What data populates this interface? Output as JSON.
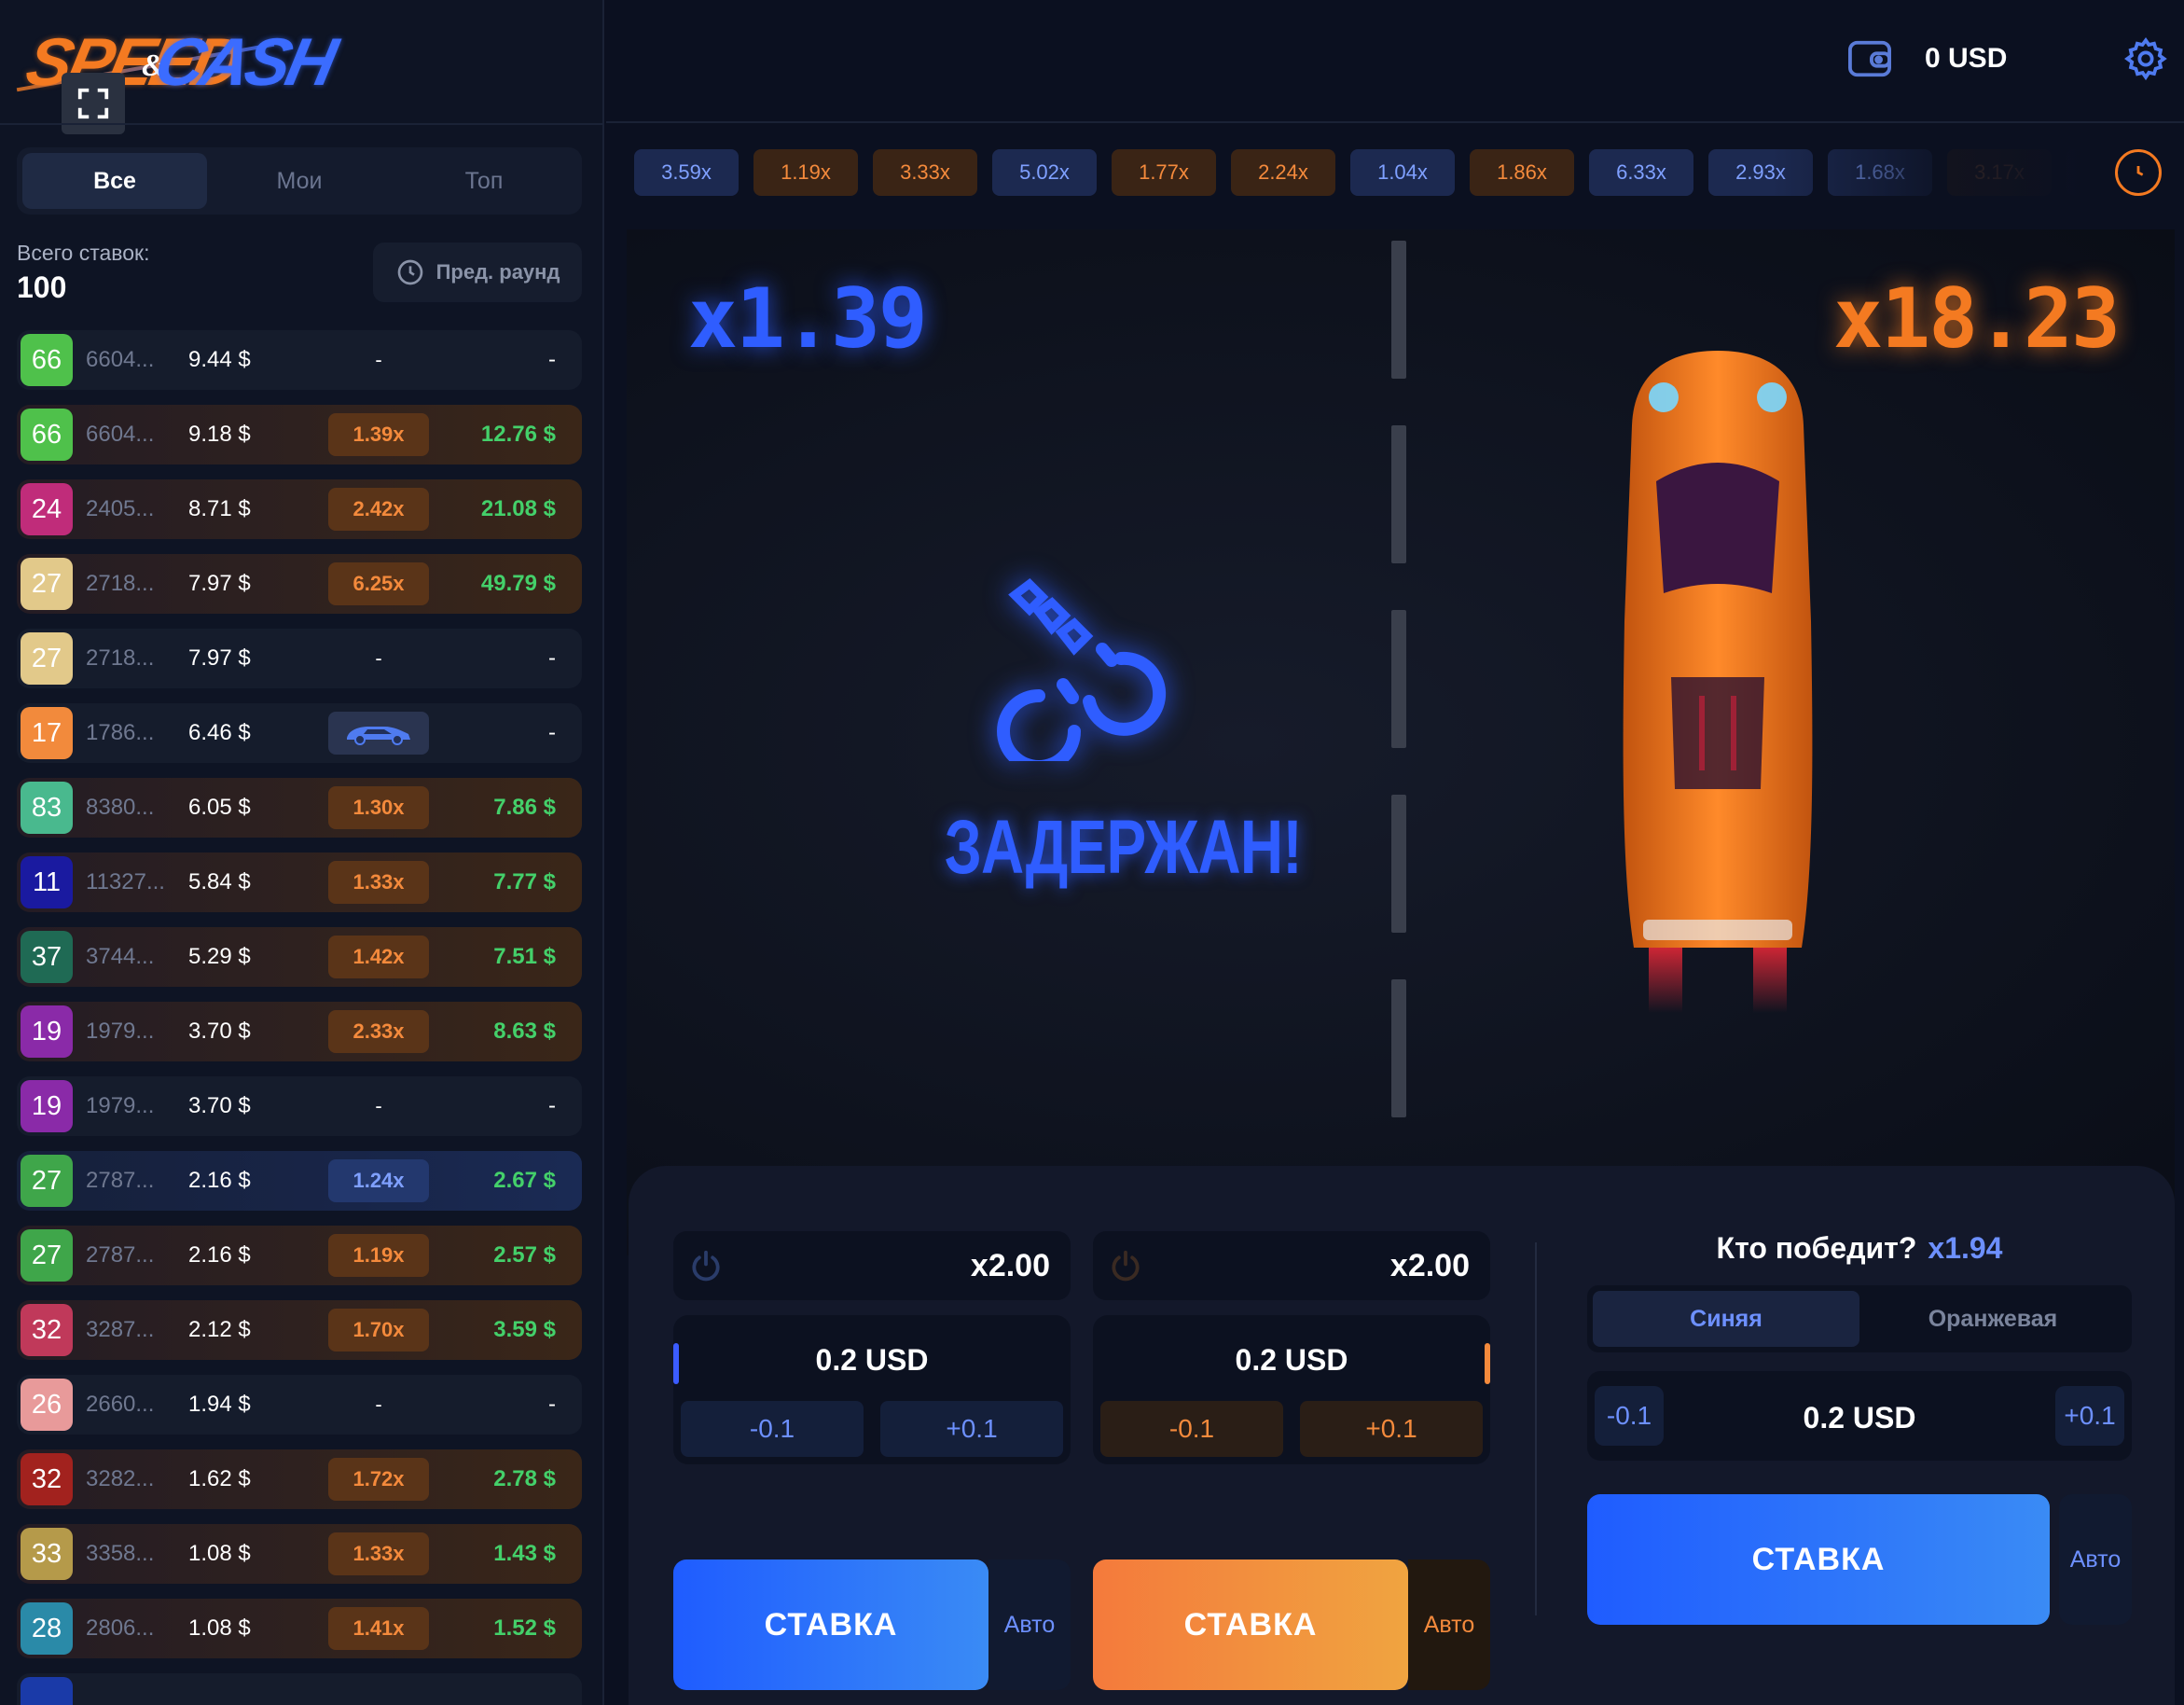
{
  "brand": {
    "word1": "SPEED",
    "amp": "&",
    "word2": "CASH"
  },
  "filters": [
    "Все",
    "Мои",
    "Топ"
  ],
  "total": {
    "label": "Всего ставок:",
    "value": "100"
  },
  "prev_round": "Пред. раунд",
  "balance": "0 USD",
  "bets": [
    {
      "level": "66",
      "color": "#4fc14b",
      "uid": "6604...",
      "amount": "9.44 $",
      "mult": "-",
      "mult_type": "dash",
      "win": "-",
      "row": "plain"
    },
    {
      "level": "66",
      "color": "#4fc14b",
      "uid": "6604...",
      "amount": "9.18 $",
      "mult": "1.39x",
      "mult_type": "orange",
      "win": "12.76 $",
      "row": "win"
    },
    {
      "level": "24",
      "color": "#c02c7a",
      "uid": "2405...",
      "amount": "8.71 $",
      "mult": "2.42x",
      "mult_type": "orange",
      "win": "21.08 $",
      "row": "win"
    },
    {
      "level": "27",
      "color": "#e2c98a",
      "uid": "2718...",
      "amount": "7.97 $",
      "mult": "6.25x",
      "mult_type": "orange",
      "win": "49.79 $",
      "row": "win"
    },
    {
      "level": "27",
      "color": "#e2c98a",
      "uid": "2718...",
      "amount": "7.97 $",
      "mult": "-",
      "mult_type": "dash",
      "win": "-",
      "row": "plain"
    },
    {
      "level": "17",
      "color": "#f28a3c",
      "uid": "1786...",
      "amount": "6.46 $",
      "mult": "",
      "mult_type": "car",
      "win": "-",
      "row": "plain"
    },
    {
      "level": "83",
      "color": "#49b98e",
      "uid": "8380...",
      "amount": "6.05 $",
      "mult": "1.30x",
      "mult_type": "orange",
      "win": "7.86 $",
      "row": "win"
    },
    {
      "level": "11",
      "color": "#1a1aa0",
      "uid": "11327...",
      "amount": "5.84 $",
      "mult": "1.33x",
      "mult_type": "orange",
      "win": "7.77 $",
      "row": "win"
    },
    {
      "level": "37",
      "color": "#1f6a54",
      "uid": "3744...",
      "amount": "5.29 $",
      "mult": "1.42x",
      "mult_type": "orange",
      "win": "7.51 $",
      "row": "win"
    },
    {
      "level": "19",
      "color": "#8a2aa8",
      "uid": "1979...",
      "amount": "3.70 $",
      "mult": "2.33x",
      "mult_type": "orange",
      "win": "8.63 $",
      "row": "win"
    },
    {
      "level": "19",
      "color": "#8a2aa8",
      "uid": "1979...",
      "amount": "3.70 $",
      "mult": "-",
      "mult_type": "dash",
      "win": "-",
      "row": "plain"
    },
    {
      "level": "27",
      "color": "#3fa64a",
      "uid": "2787...",
      "amount": "2.16 $",
      "mult": "1.24x",
      "mult_type": "blue",
      "win": "2.67 $",
      "row": "win-blue"
    },
    {
      "level": "27",
      "color": "#3fa64a",
      "uid": "2787...",
      "amount": "2.16 $",
      "mult": "1.19x",
      "mult_type": "orange",
      "win": "2.57 $",
      "row": "win"
    },
    {
      "level": "32",
      "color": "#c0395a",
      "uid": "3287...",
      "amount": "2.12 $",
      "mult": "1.70x",
      "mult_type": "orange",
      "win": "3.59 $",
      "row": "win"
    },
    {
      "level": "26",
      "color": "#e89a9a",
      "uid": "2660...",
      "amount": "1.94 $",
      "mult": "-",
      "mult_type": "dash",
      "win": "-",
      "row": "plain"
    },
    {
      "level": "32",
      "color": "#a2221e",
      "uid": "3282...",
      "amount": "1.62 $",
      "mult": "1.72x",
      "mult_type": "orange",
      "win": "2.78 $",
      "row": "win"
    },
    {
      "level": "33",
      "color": "#b59a4a",
      "uid": "3358...",
      "amount": "1.08 $",
      "mult": "1.33x",
      "mult_type": "orange",
      "win": "1.43 $",
      "row": "win"
    },
    {
      "level": "28",
      "color": "#2a8aa8",
      "uid": "2806...",
      "amount": "1.08 $",
      "mult": "1.41x",
      "mult_type": "orange",
      "win": "1.52 $",
      "row": "win"
    },
    {
      "level": "",
      "color": "#1a3aa8",
      "uid": "",
      "amount": "",
      "mult": "",
      "mult_type": "dash",
      "win": "",
      "row": "plain"
    }
  ],
  "history": [
    {
      "v": "3.59x",
      "c": "blue"
    },
    {
      "v": "1.19x",
      "c": "orange"
    },
    {
      "v": "3.33x",
      "c": "orange"
    },
    {
      "v": "5.02x",
      "c": "blue"
    },
    {
      "v": "1.77x",
      "c": "orange"
    },
    {
      "v": "2.24x",
      "c": "orange"
    },
    {
      "v": "1.04x",
      "c": "blue"
    },
    {
      "v": "1.86x",
      "c": "orange"
    },
    {
      "v": "6.33x",
      "c": "blue"
    },
    {
      "v": "2.93x",
      "c": "blue"
    },
    {
      "v": "1.68x",
      "c": "blue"
    },
    {
      "v": "3.17x",
      "c": "orange"
    },
    {
      "v": "",
      "c": "blue"
    }
  ],
  "game": {
    "mult_blue": "x1.39",
    "mult_orange": "x18.23",
    "status": "ЗАДЕРЖАН!"
  },
  "panel_blue": {
    "auto_mult": "x2.00",
    "amount": "0.2 USD",
    "minus": "-0.1",
    "plus": "+0.1",
    "bet": "СТАВКА",
    "auto": "Авто"
  },
  "panel_orange": {
    "auto_mult": "x2.00",
    "amount": "0.2 USD",
    "minus": "-0.1",
    "plus": "+0.1",
    "bet": "СТАВКА",
    "auto": "Авто"
  },
  "who_wins": {
    "title": "Кто победит?",
    "mult": "x1.94",
    "teams": [
      "Синяя",
      "Оранжевая"
    ],
    "amount": "0.2 USD",
    "minus": "-0.1",
    "plus": "+0.1",
    "bet": "СТАВКА",
    "auto": "Авто"
  },
  "colors": {
    "blue_accent": "#2f5dff",
    "orange_accent": "#f47a21",
    "win_green": "#44d06a"
  }
}
